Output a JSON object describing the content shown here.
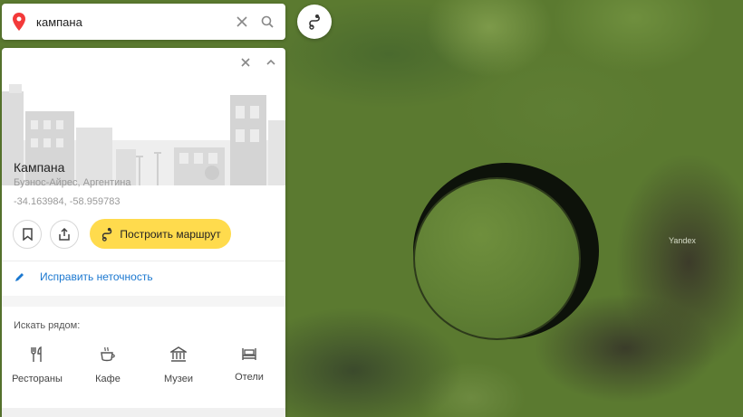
{
  "search": {
    "value": "кампана",
    "placeholder": ""
  },
  "place": {
    "title": "Кампана",
    "subtitle": "Буэнос-Айрес, Аргентина",
    "coords": "-34.163984, -58.959783"
  },
  "actions": {
    "route_label": "Построить маршрут"
  },
  "fix": {
    "label": "Исправить неточность"
  },
  "nearby": {
    "title": "Искать рядом:",
    "categories": [
      {
        "label": "Рестораны",
        "icon": "fork-knife-icon"
      },
      {
        "label": "Кафе",
        "icon": "coffee-cup-icon"
      },
      {
        "label": "Музеи",
        "icon": "museum-icon"
      },
      {
        "label": "Отели",
        "icon": "bed-icon"
      }
    ]
  },
  "map": {
    "watermark": "Yandex"
  },
  "colors": {
    "accent": "#ffdb4d",
    "link": "#1b78d0",
    "pin": "#f33a3a"
  }
}
